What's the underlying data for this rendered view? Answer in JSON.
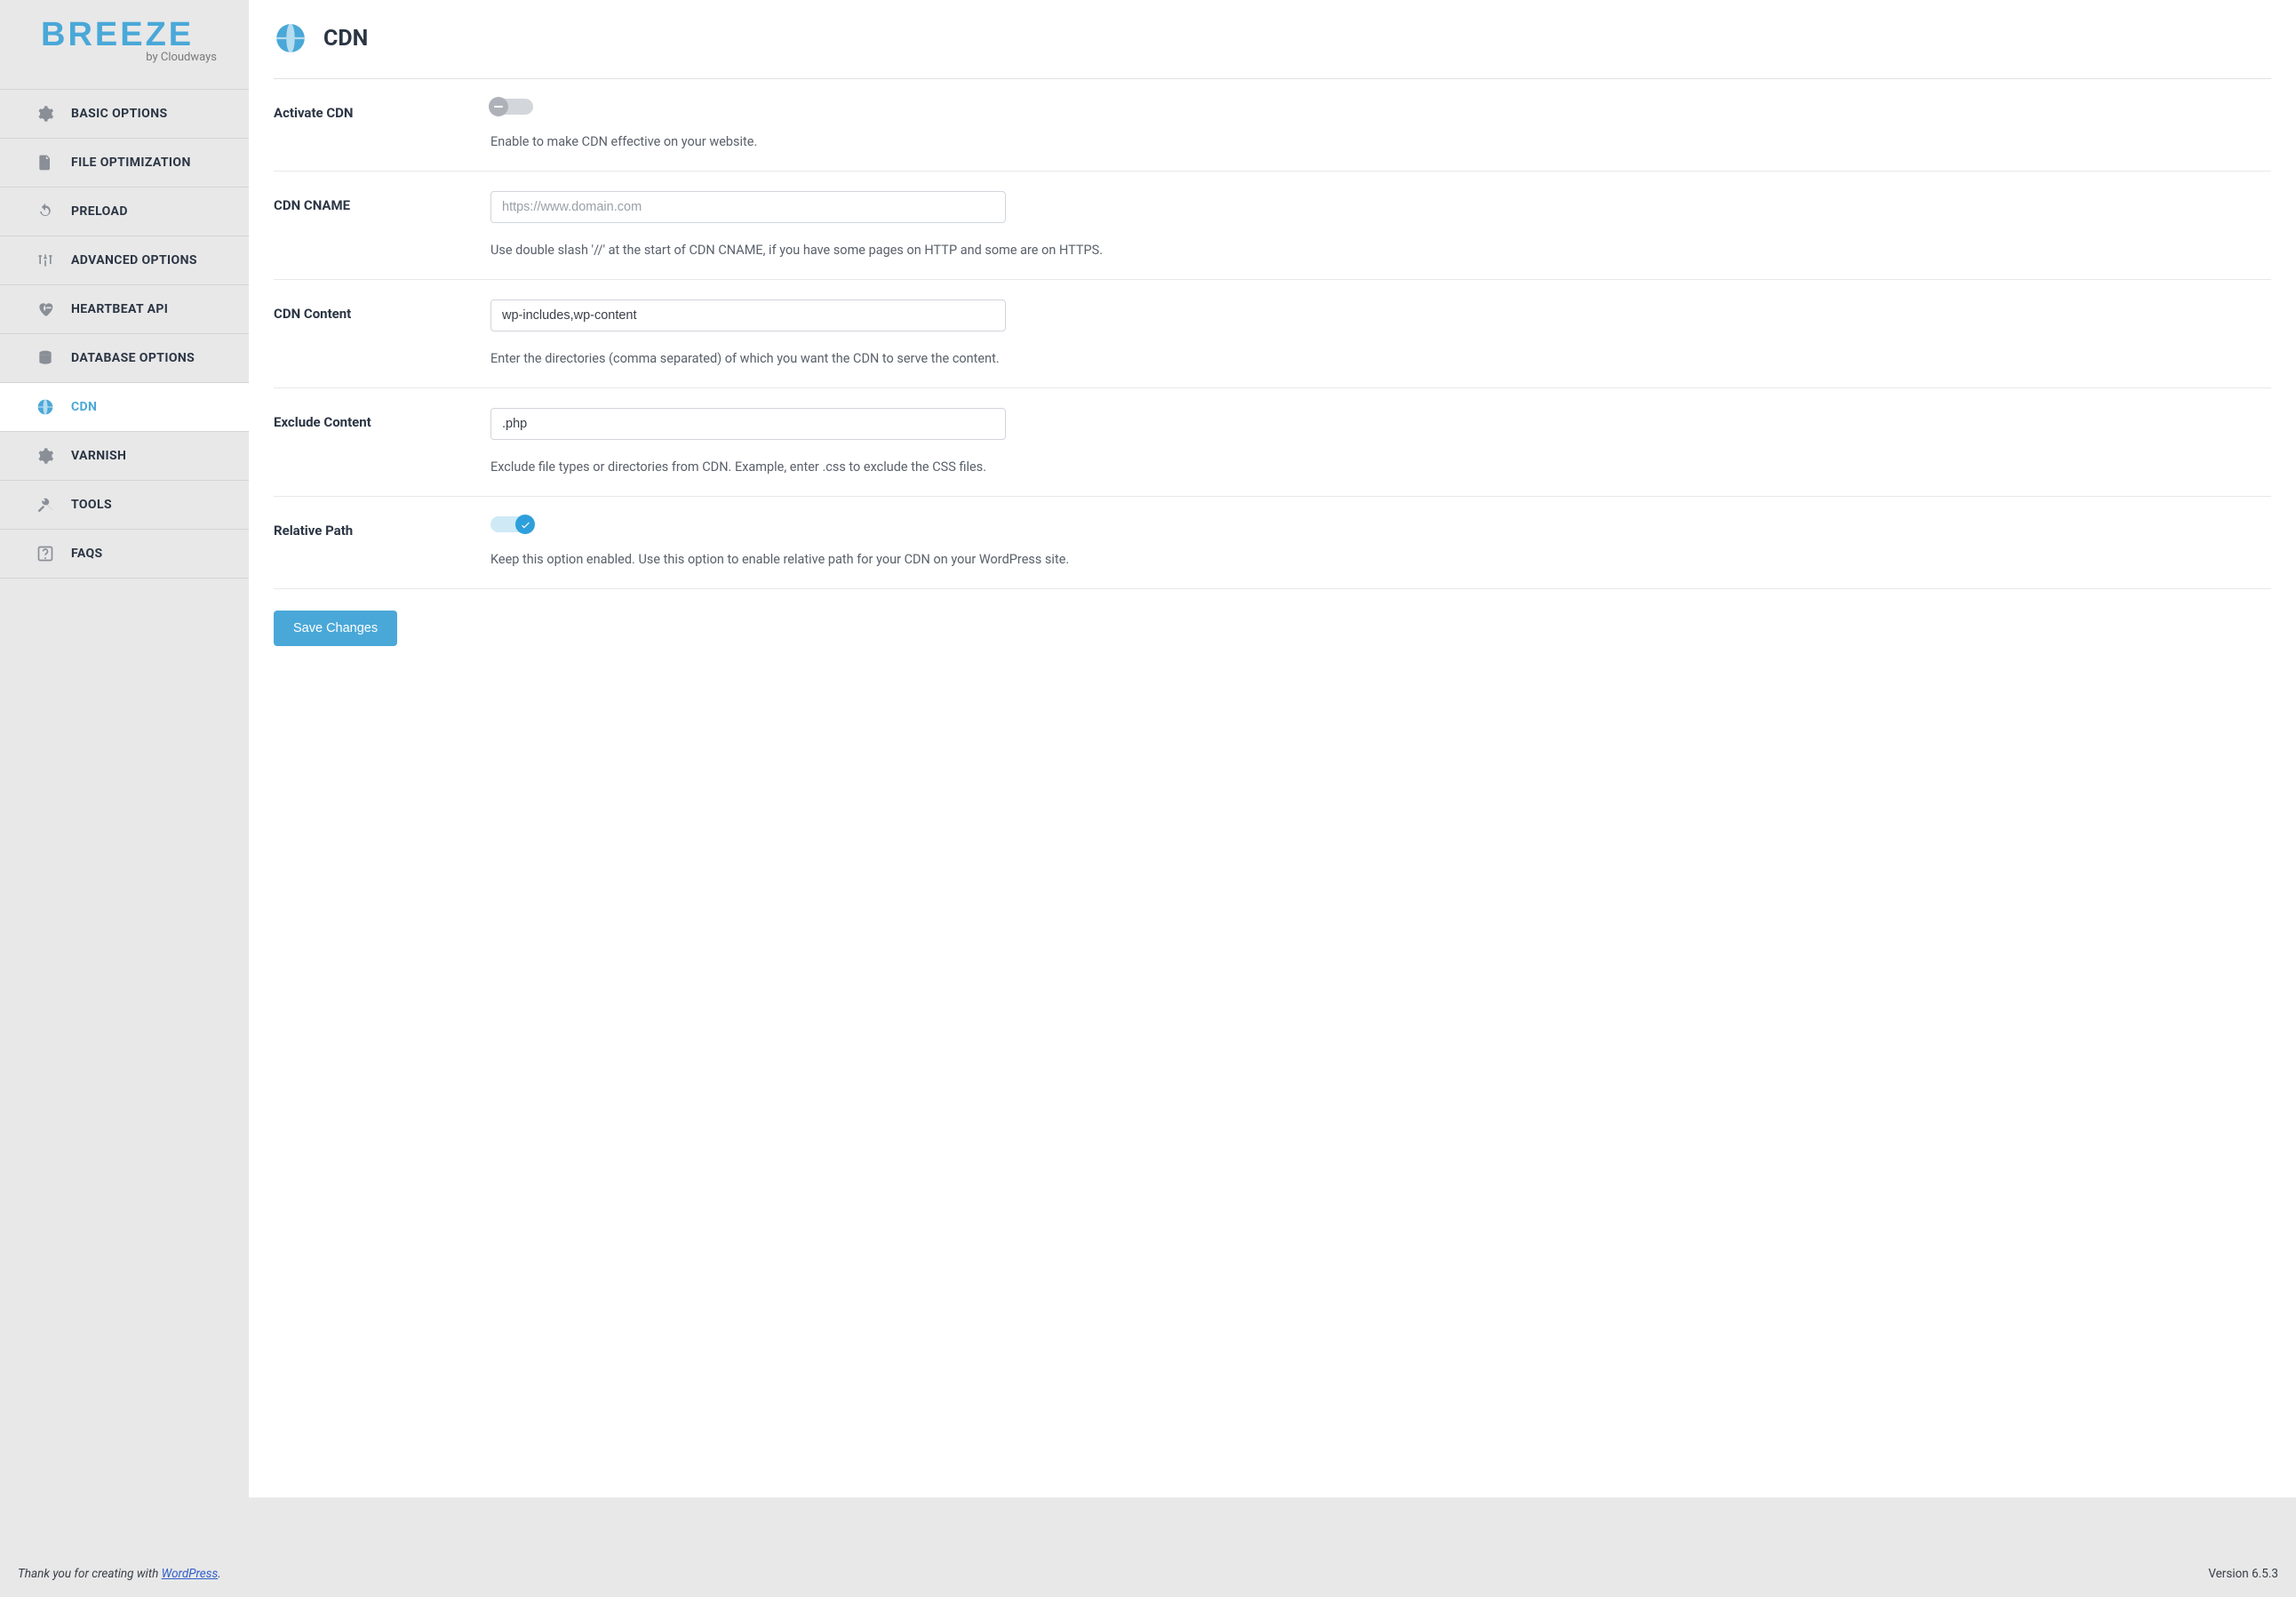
{
  "brand": {
    "name": "BREEZE",
    "tagline": "by Cloudways"
  },
  "sidebar": {
    "items": [
      {
        "label": "BASIC OPTIONS",
        "icon": "gear-icon"
      },
      {
        "label": "FILE OPTIMIZATION",
        "icon": "file-icon"
      },
      {
        "label": "PRELOAD",
        "icon": "reload-icon"
      },
      {
        "label": "ADVANCED OPTIONS",
        "icon": "sliders-icon"
      },
      {
        "label": "HEARTBEAT API",
        "icon": "heartbeat-icon"
      },
      {
        "label": "DATABASE OPTIONS",
        "icon": "database-icon"
      },
      {
        "label": "CDN",
        "icon": "globe-icon",
        "active": true
      },
      {
        "label": "VARNISH",
        "icon": "gear-icon"
      },
      {
        "label": "TOOLS",
        "icon": "tools-icon"
      },
      {
        "label": "FAQS",
        "icon": "faq-icon"
      }
    ]
  },
  "page": {
    "icon": "globe-icon",
    "title": "CDN"
  },
  "settings": {
    "activate_cdn": {
      "label": "Activate CDN",
      "enabled": false,
      "desc": "Enable to make CDN effective on your website."
    },
    "cdn_cname": {
      "label": "CDN CNAME",
      "placeholder": "https://www.domain.com",
      "value": "",
      "desc": "Use double slash '//' at the start of CDN CNAME, if you have some pages on HTTP and some are on HTTPS."
    },
    "cdn_content": {
      "label": "CDN Content",
      "value": "wp-includes,wp-content",
      "desc": "Enter the directories (comma separated) of which you want the CDN to serve the content."
    },
    "exclude_content": {
      "label": "Exclude Content",
      "value": ".php",
      "desc": "Exclude file types or directories from CDN. Example, enter .css to exclude the CSS files."
    },
    "relative_path": {
      "label": "Relative Path",
      "enabled": true,
      "desc": "Keep this option enabled. Use this option to enable relative path for your CDN on your WordPress site."
    }
  },
  "buttons": {
    "save": "Save Changes"
  },
  "footer": {
    "thanks_prefix": "Thank you for creating with ",
    "link_text": "WordPress",
    "thanks_suffix": ".",
    "version": "Version 6.5.3"
  }
}
